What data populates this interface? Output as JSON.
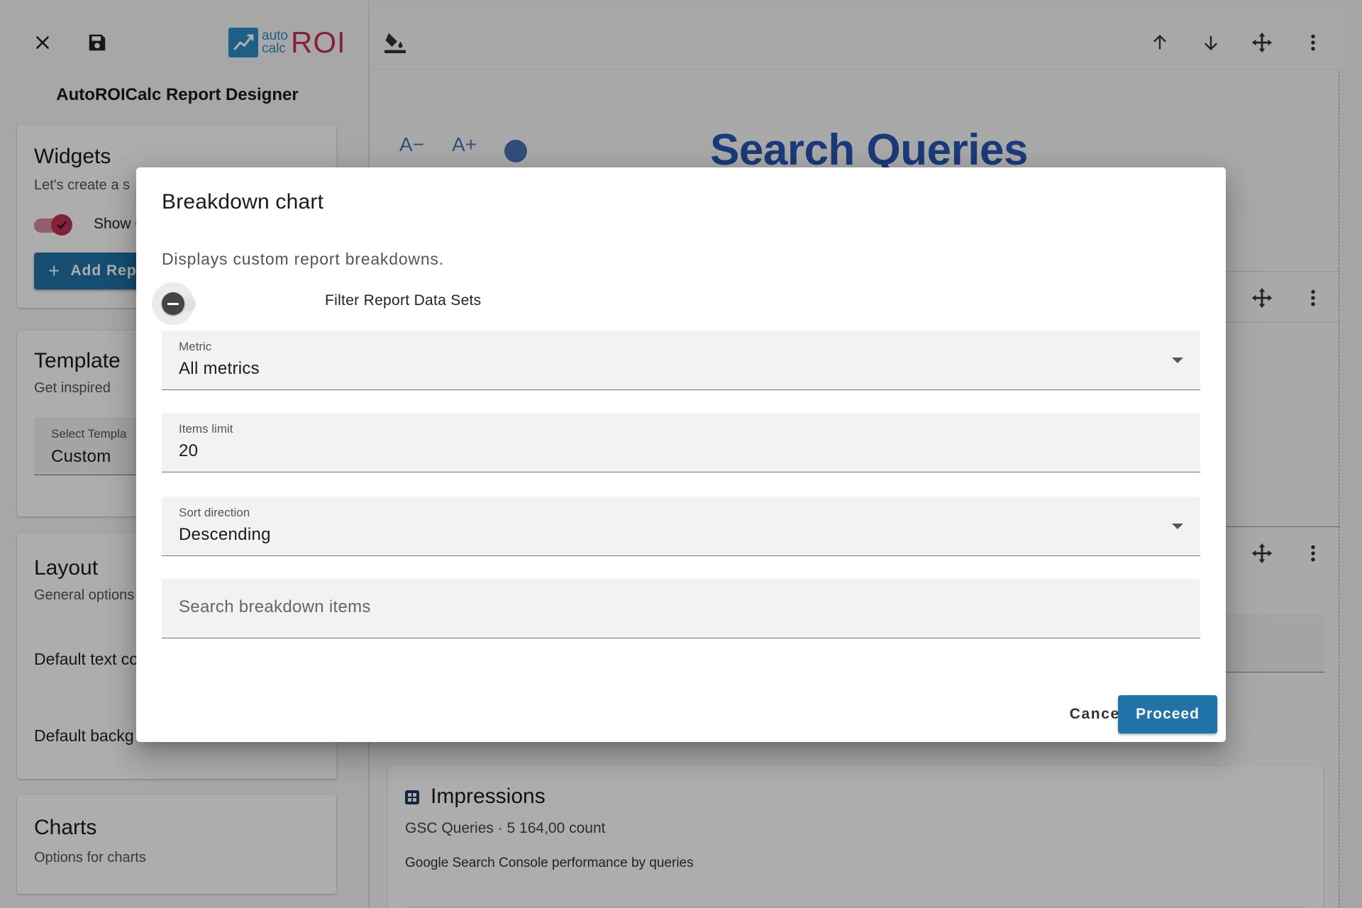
{
  "sidebar": {
    "close_icon": "close-icon",
    "save_icon": "save-icon",
    "logo": {
      "small_top": "auto",
      "small_bottom": "calc",
      "big": "ROI"
    },
    "designer_title": "AutoROICalc Report Designer",
    "widgets": {
      "title": "Widgets",
      "subtitle": "Let's create a s",
      "toggle_label": "Show Co",
      "toggle_on": true,
      "add_button": "Add Rep"
    },
    "template": {
      "title": "Template",
      "subtitle": "Get inspired",
      "select_label": "Select Templa",
      "select_value": "Custom"
    },
    "layout": {
      "title": "Layout",
      "subtitle": "General options",
      "default_text": "Default text co",
      "default_background": "Default backg"
    },
    "charts": {
      "title": "Charts",
      "subtitle": "Options for charts"
    }
  },
  "main": {
    "toolbar_icons": [
      "paint-bucket-icon",
      "arrow-up-icon",
      "arrow-down-icon",
      "move-icon",
      "more-vert-icon"
    ],
    "font_decrease": "A−",
    "font_increase": "A+",
    "report_title": "Search Queries",
    "impressions": {
      "title": "Impressions",
      "meta": "GSC Queries · 5 164,00 count",
      "description": "Google Search Console performance by queries"
    }
  },
  "dialog": {
    "title": "Breakdown chart",
    "description": "Displays custom report breakdowns.",
    "filter_label": "Filter Report Data Sets",
    "filter_on": false,
    "metric": {
      "label": "Metric",
      "value": "All metrics"
    },
    "items_limit": {
      "label": "Items limit",
      "value": "20"
    },
    "sort_direction": {
      "label": "Sort direction",
      "value": "Descending"
    },
    "search": {
      "placeholder": "Search breakdown items"
    },
    "cancel_label": "Cancel",
    "proceed_label": "Proceed"
  },
  "colors": {
    "primary": "#1f73a8",
    "title_blue": "#2557b3",
    "toggle_pink": "#c53055",
    "logo_blue": "#2a8fc5"
  }
}
